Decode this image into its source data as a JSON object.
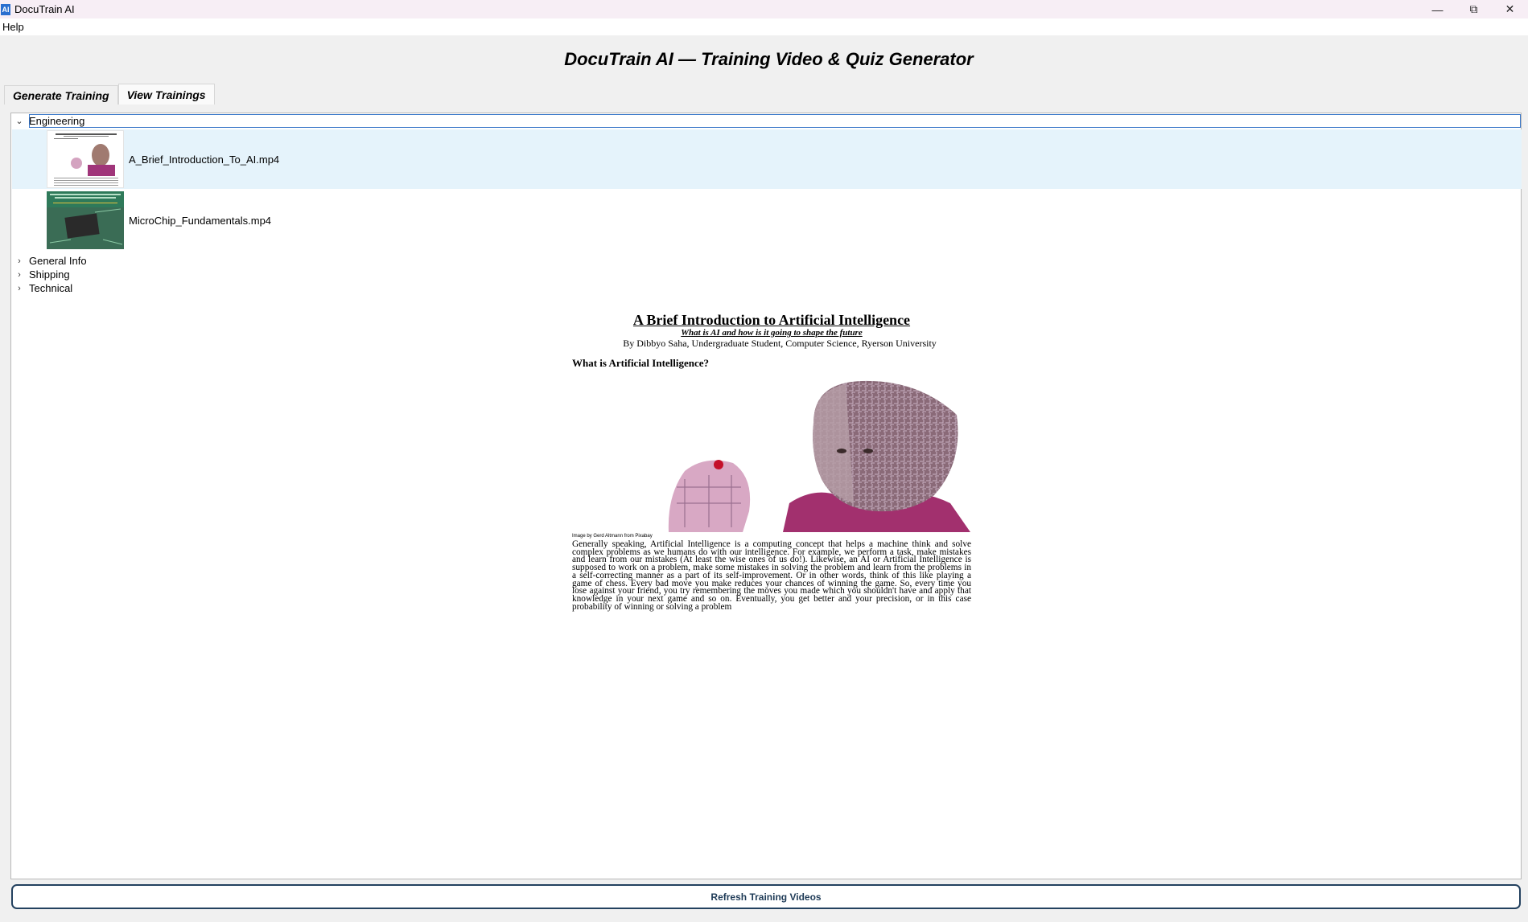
{
  "window": {
    "title": "DocuTrain AI",
    "icon_text": "AI",
    "controls": [
      "minimize",
      "restore",
      "close"
    ]
  },
  "menu": {
    "items": [
      "Help"
    ]
  },
  "heading": "DocuTrain AI — Training Video & Quiz Generator",
  "tabs": [
    {
      "label": "Generate Training",
      "active": false
    },
    {
      "label": "View Trainings",
      "active": true
    }
  ],
  "tree": {
    "groups": [
      {
        "label": "Engineering",
        "expanded": true,
        "selected": true,
        "videos": [
          {
            "label": "A_Brief_Introduction_To_AI.mp4",
            "selected": true
          },
          {
            "label": "MicroChip_Fundamentals.mp4",
            "selected": false
          }
        ]
      },
      {
        "label": "General Info",
        "expanded": false
      },
      {
        "label": "Shipping",
        "expanded": false
      },
      {
        "label": "Technical",
        "expanded": false
      }
    ]
  },
  "preview": {
    "title": "A Brief Introduction to Artificial Intelligence",
    "subtitle": "What is AI and how is it going to shape the future",
    "author": "By Dibbyo Saha, Undergraduate Student, Computer Science, Ryerson University",
    "heading": "What is Artificial Intelligence?",
    "caption": "Image by Gerd Altmann from Pixabay",
    "body": "Generally speaking, Artificial Intelligence is a computing concept that helps a machine think and solve complex problems as we humans do with our intelligence. For example, we perform a task, make mistakes and learn from our mistakes (At least the wise ones of us do!). Likewise, an AI or Artificial Intelligence is supposed to work on a problem, make some mistakes in solving the problem and learn from the problems in a self-correcting manner as a part of its self-improvement. Or in other words, think of this like playing a game of chess. Every bad move you make reduces your chances of winning the game. So, every time you lose against your friend, you try remembering the moves you made which you shouldn't have and apply that knowledge in your next game and so on. Eventually, you get better and your precision, or in this case probability of winning or solving a problem"
  },
  "refresh_button": "Refresh Training Videos",
  "colors": {
    "selection_bg": "#e5f3fb",
    "focus_border": "#3a78c9",
    "button_border": "#23415f"
  }
}
